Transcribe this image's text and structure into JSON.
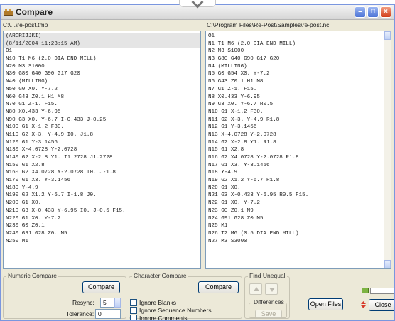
{
  "window": {
    "title": "Compare"
  },
  "paths": {
    "left": "C:\\...\\re-post.tmp",
    "right": "C:\\Program Files\\Re-Post\\Samples\\re-post.nc"
  },
  "left_lines": [
    "(ARCRIJJKI)",
    "(8/11/2004 11:23:15 AM)",
    "O1",
    "N10 T1 M6 (2.0 DIA END MILL)",
    "N20 M3 S1000",
    "N30 G80 G40 G90 G17 G20",
    "N40 (MILLING)",
    "N50 G0 X0. Y-7.2",
    "N60 G43 Z0.1 H1 M8",
    "N70 G1 Z-1. F15.",
    "N80 X0.433 Y-6.95",
    "N90 G3 X0. Y-6.7 I-0.433 J-0.25",
    "N100 G1 X-1.2 F30.",
    "N110 G2 X-3. Y-4.9 I0. J1.8",
    "N120 G1 Y-3.1456",
    "N130 X-4.0728 Y-2.0728",
    "N140 G2 X-2.8 Y1. I1.2728 J1.2728",
    "N150 G1 X2.8",
    "N160 G2 X4.0728 Y-2.0728 I0. J-1.8",
    "N170 G1 X3. Y-3.1456",
    "N180 Y-4.9",
    "N190 G2 X1.2 Y-6.7 I-1.8 J0.",
    "N200 G1 X0.",
    "N210 G3 X-0.433 Y-6.95 I0. J-0.5 F15.",
    "N220 G1 X0. Y-7.2",
    "N230 G0 Z0.1",
    "N240 G91 G28 Z0. M5",
    "N250 M1"
  ],
  "right_lines": [
    "O1",
    "N1 T1 M6 (2.0 DIA END MILL)",
    "N2 M3 S1000",
    "N3 G80 G40 G90 G17 G20",
    "N4 (MILLING)",
    "N5 G0 G54 X0. Y-7.2",
    "N6 G43 Z0.1 H1 M8",
    "N7 G1 Z-1. F15.",
    "N8 X0.433 Y-6.95",
    "N9 G3 X0. Y-6.7 R0.5",
    "N10 G1 X-1.2 F30.",
    "N11 G2 X-3. Y-4.9 R1.8",
    "N12 G1 Y-3.1456",
    "N13 X-4.0728 Y-2.0728",
    "N14 G2 X-2.8 Y1. R1.8",
    "N15 G1 X2.8",
    "N16 G2 X4.0728 Y-2.0728 R1.8",
    "N17 G1 X3. Y-3.1456",
    "N18 Y-4.9",
    "N19 G2 X1.2 Y-6.7 R1.8",
    "N20 G1 X0.",
    "N21 G3 X-0.433 Y-6.95 R0.5 F15.",
    "N22 G1 X0. Y-7.2",
    "N23 G0 Z0.1 M9",
    "N24 G91 G28 Z0 M5",
    "N25 M1",
    "N26 T2 M6 (0.5 DIA END MILL)",
    "N27 M3 S3000"
  ],
  "numeric_compare": {
    "label": "Numeric Compare",
    "compare_button": "Compare",
    "resync_label": "Resync:",
    "resync_value": "5",
    "tolerance_label": "Tolerance:",
    "tolerance_value": "0"
  },
  "character_compare": {
    "label": "Character Compare",
    "compare_button": "Compare",
    "options": [
      "Ignore Blanks",
      "Ignore Sequence Numbers",
      "Ignore Comments"
    ]
  },
  "find_unequal": {
    "label": "Find Unequal"
  },
  "differences": {
    "label": "Differences",
    "save_button": "Save"
  },
  "buttons": {
    "open_files": "Open Files",
    "close": "Close"
  },
  "colors": {
    "titlebar_blue": "#4d74d6",
    "close_red": "#d13d1a",
    "face": "#ece9d8",
    "border": "#7f9db9"
  }
}
